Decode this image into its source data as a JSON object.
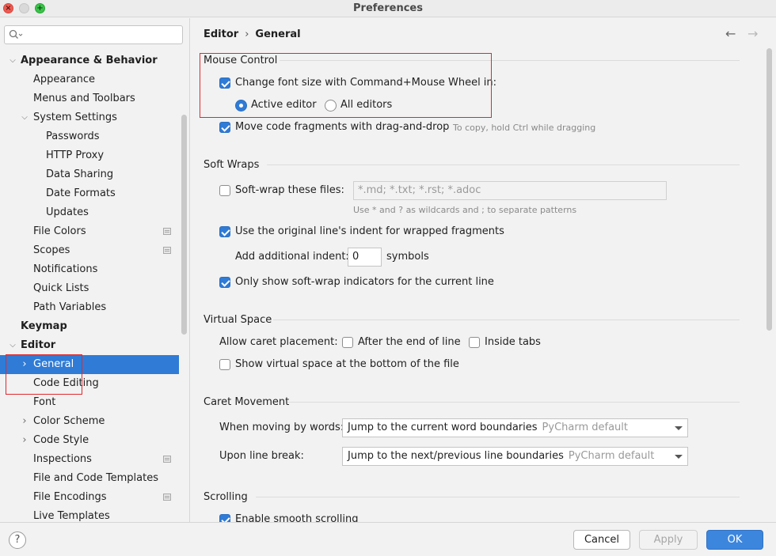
{
  "window": {
    "title": "Preferences"
  },
  "colors": {
    "accent": "#2f7bd6",
    "highlight": "#e0282e"
  },
  "sidebar": {
    "items": [
      {
        "label": "Appearance & Behavior"
      },
      {
        "label": "Appearance"
      },
      {
        "label": "Menus and Toolbars"
      },
      {
        "label": "System Settings"
      },
      {
        "label": "Passwords"
      },
      {
        "label": "HTTP Proxy"
      },
      {
        "label": "Data Sharing"
      },
      {
        "label": "Date Formats"
      },
      {
        "label": "Updates"
      },
      {
        "label": "File Colors"
      },
      {
        "label": "Scopes"
      },
      {
        "label": "Notifications"
      },
      {
        "label": "Quick Lists"
      },
      {
        "label": "Path Variables"
      },
      {
        "label": "Keymap"
      },
      {
        "label": "Editor"
      },
      {
        "label": "General"
      },
      {
        "label": "Code Editing"
      },
      {
        "label": "Font"
      },
      {
        "label": "Color Scheme"
      },
      {
        "label": "Code Style"
      },
      {
        "label": "Inspections"
      },
      {
        "label": "File and Code Templates"
      },
      {
        "label": "File Encodings"
      },
      {
        "label": "Live Templates"
      }
    ]
  },
  "breadcrumb": {
    "parent": "Editor",
    "sep": "›",
    "current": "General"
  },
  "nav": {
    "back": "←",
    "forward": "→"
  },
  "mouse_control": {
    "title": "Mouse Control",
    "font_size_wheel": "Change font size with Command+Mouse Wheel in:",
    "active_editor": "Active editor",
    "all_editors": "All editors",
    "drag_drop": "Move code fragments with drag-and-drop",
    "drag_drop_hint": "To copy, hold Ctrl while dragging"
  },
  "soft_wraps": {
    "title": "Soft Wraps",
    "soft_wrap_files": "Soft-wrap these files:",
    "files_placeholder": "*.md; *.txt; *.rst; *.adoc",
    "files_hint": "Use * and ? as wildcards and ; to separate patterns",
    "original_indent": "Use the original line's indent for wrapped fragments",
    "additional_indent": "Add additional indent:",
    "indent_value": "0",
    "symbols": "symbols",
    "indicators": "Only show soft-wrap indicators for the current line"
  },
  "virtual_space": {
    "title": "Virtual Space",
    "allow_caret": "Allow caret placement:",
    "after_end": "After the end of line",
    "inside_tabs": "Inside tabs",
    "show_bottom": "Show virtual space at the bottom of the file"
  },
  "caret_movement": {
    "title": "Caret Movement",
    "by_words_label": "When moving by words:",
    "by_words_value": "Jump to the current word boundaries",
    "by_words_default": "PyCharm default",
    "line_break_label": "Upon line break:",
    "line_break_value": "Jump to the next/previous line boundaries",
    "line_break_default": "PyCharm default"
  },
  "scrolling": {
    "title": "Scrolling",
    "smooth": "Enable smooth scrolling"
  },
  "footer": {
    "help": "?",
    "cancel": "Cancel",
    "apply": "Apply",
    "ok": "OK"
  }
}
